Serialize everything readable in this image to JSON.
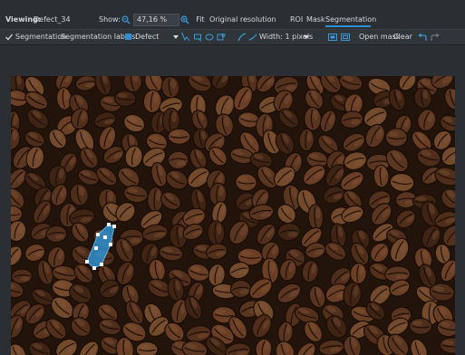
{
  "viewer": {
    "viewing_label": "Viewing:",
    "image_name": "Defect_34",
    "show_label": "Show:",
    "zoom": "47,16 %",
    "fit_label": "Fit",
    "original_label": "Original resolution",
    "tabs": [
      {
        "label": "ROI"
      },
      {
        "label": "Mask"
      },
      {
        "label": "Segmentation"
      }
    ]
  },
  "toolbar": {
    "segmentation_checkbox_label": "Segmentation",
    "labels_title": "Segmentation labels:",
    "selected_label": "Defect",
    "label_color": "#2f8fd0",
    "width_label": "Width: 1 pixels",
    "open_mask_label": "Open mask",
    "clear_label": "Clear"
  }
}
